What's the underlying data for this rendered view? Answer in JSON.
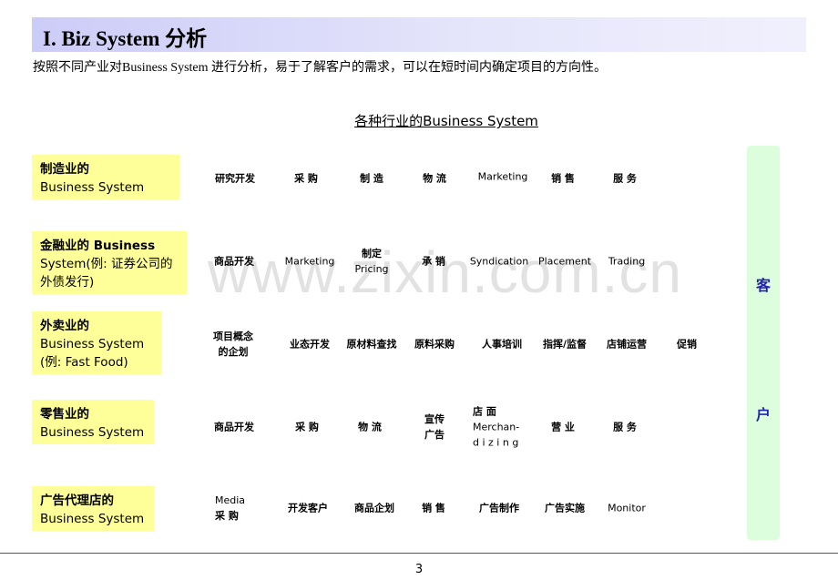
{
  "title": "I. Biz System 分析",
  "subtitle": "按照不同产业对Business System 进行分析，易于了解客户的需求，可以在短时间内确定项目的方向性。",
  "heading": "各种行业的Business System",
  "watermark": "www.zixin.com.cn",
  "customer": {
    "line1": "客",
    "line2": "户"
  },
  "colors": {
    "label_bg": "#ffff99",
    "customer_bg": "#dcfedc",
    "customer_text": "#2323b0",
    "title_bar": "#ccccf8"
  },
  "rows": [
    {
      "label": [
        "制造业的",
        "Business System"
      ],
      "items": [
        [
          "研究开发"
        ],
        [
          "采  购"
        ],
        [
          "制  造"
        ],
        [
          "物  流"
        ],
        [
          "Marketing"
        ],
        [
          "销  售"
        ],
        [
          "服  务"
        ]
      ]
    },
    {
      "label": [
        "金融业的 Business",
        "System(例: 证券公司的",
        "外债发行)"
      ],
      "items": [
        [
          "商品开发"
        ],
        [
          "Marketing"
        ],
        [
          "制定",
          "Pricing"
        ],
        [
          "承  销"
        ],
        [
          "Syndication"
        ],
        [
          "Placement"
        ],
        [
          "Trading"
        ]
      ]
    },
    {
      "label": [
        "外卖业的",
        "Business System",
        "(例: Fast Food)"
      ],
      "items": [
        [
          "项目概念",
          "的企划"
        ],
        [
          "业态开发"
        ],
        [
          "原材料查找"
        ],
        [
          "原料采购"
        ],
        [
          "人事培训"
        ],
        [
          "指挥/监督"
        ],
        [
          "店铺运营"
        ],
        [
          "促销"
        ]
      ]
    },
    {
      "label": [
        "零售业的",
        "Business System"
      ],
      "items": [
        [
          "商品开发"
        ],
        [
          "采  购"
        ],
        [
          "物  流"
        ],
        [
          "宣传",
          "广告"
        ],
        [
          "店    面",
          "Merchan-",
          "d i z i n g"
        ],
        [
          "营  业"
        ],
        [
          "服  务"
        ]
      ]
    },
    {
      "label": [
        "广告代理店的",
        "Business System"
      ],
      "items": [
        [
          "Media",
          "采 购"
        ],
        [
          "开发客户"
        ],
        [
          "商品企划"
        ],
        [
          "销  售"
        ],
        [
          "广告制作"
        ],
        [
          "广告实施"
        ],
        [
          "Monitor"
        ]
      ]
    }
  ],
  "page_number": "3"
}
